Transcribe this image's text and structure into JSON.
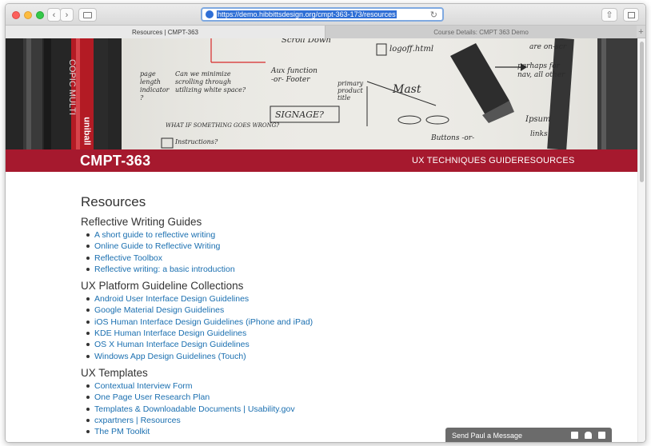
{
  "browser": {
    "url": "https://demo.hibbittsdesign.org/cmpt-363-173/resources",
    "tabs": [
      {
        "label": "Resources | CMPT-363",
        "active": true
      },
      {
        "label": "Course Details: CMPT 363 Demo",
        "active": false
      }
    ],
    "new_tab_label": "+"
  },
  "site": {
    "title": "CMPT-363",
    "nav": [
      "UX TECHNIQUES GUIDE",
      "RESOURCES"
    ],
    "accent_color": "#a6192e"
  },
  "page": {
    "title": "Resources",
    "sections": [
      {
        "heading": "Reflective Writing Guides",
        "links": [
          "A short guide to reflective writing",
          "Online Guide to Reflective Writing",
          "Reflective Toolbox",
          "Reflective writing: a basic introduction"
        ]
      },
      {
        "heading": "UX Platform Guideline Collections",
        "links": [
          "Android User Interface Design Guidelines",
          "Google Material Design Guidelines",
          "iOS Human Interface Design Guidelines (iPhone and iPad)",
          "KDE Human Interface Design Guidelines",
          "OS X Human Interface Design Guidelines",
          "Windows App Design Guidelines (Touch)"
        ]
      },
      {
        "heading": "UX Templates",
        "links": [
          "Contextual Interview Form",
          "One Page User Research Plan",
          "Templates & Downloadable Documents | Usability.gov",
          "cxpartners | Resources",
          "The PM Toolkit"
        ]
      }
    ]
  },
  "chat_widget": {
    "label": "Send Paul a Message"
  },
  "hero_sketch_text": {
    "t1": "Scroll Down",
    "t2": "logoff.html",
    "t3": "page length indicator ?",
    "t4": "Can we minimize scrolling through utilizing white space?",
    "t5": "Aux function -or- Footer",
    "t6": "primary product title",
    "t7": "SIGNAGE?",
    "t8": "Mast",
    "t9": "WHAT IF SOMETHING GOES WRONG?",
    "t10": "Instructions?",
    "t11": "Buttons -or-",
    "t12": "perhaps for nav, all other",
    "t13": "Ipsum",
    "t14": "links",
    "t15": "are on-scr",
    "t16": "COPIC MULTI",
    "t17": "uniball"
  }
}
